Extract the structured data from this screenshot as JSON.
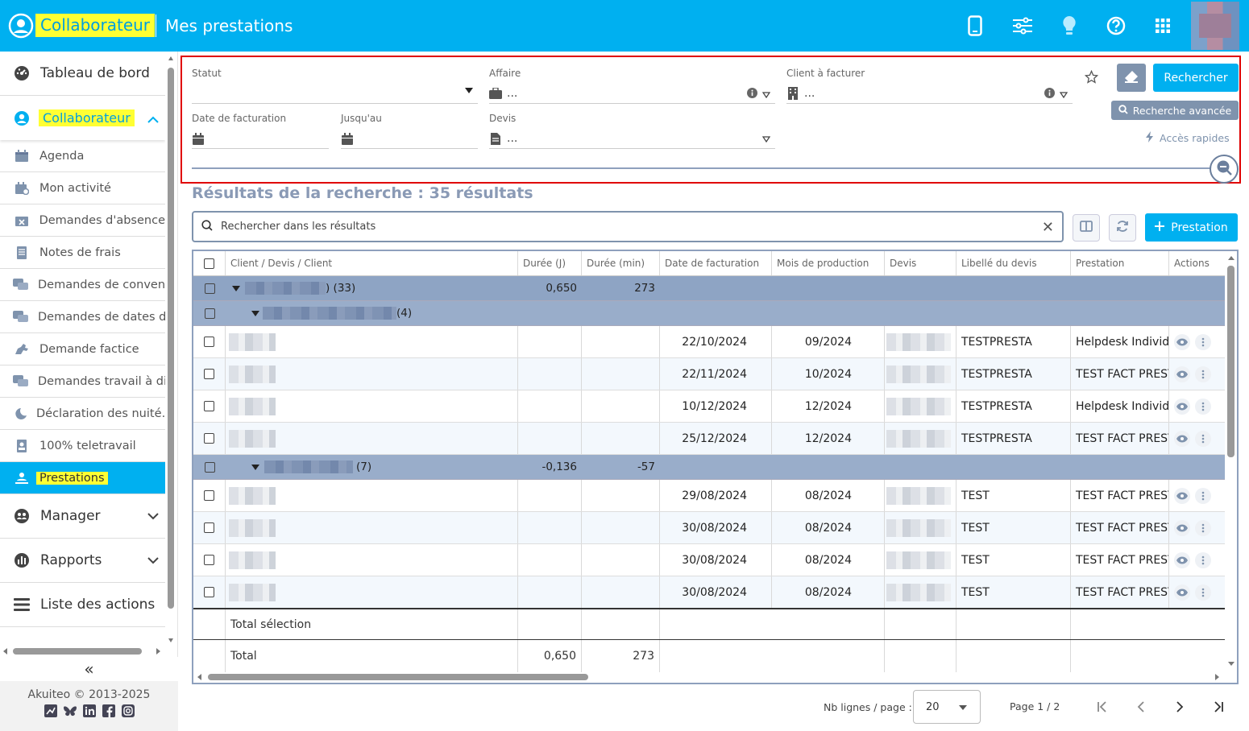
{
  "header": {
    "brand": "Collaborateur",
    "title": "Mes prestations",
    "icons": [
      "mobile-icon",
      "sliders-icon",
      "lightbulb-icon",
      "help-icon",
      "apps-grid-icon"
    ]
  },
  "sidebar": {
    "top_items": [
      {
        "label": "Tableau de bord",
        "icon": "dashboard-icon"
      }
    ],
    "section": {
      "label": "Collaborateur",
      "icon": "user-circle-icon"
    },
    "sub_items": [
      {
        "label": "Agenda",
        "icon": "calendar-icon"
      },
      {
        "label": "Mon activité",
        "icon": "calendar-user-icon"
      },
      {
        "label": "Demandes d'absence",
        "icon": "calendar-x-icon"
      },
      {
        "label": "Notes de frais",
        "icon": "receipt-icon"
      },
      {
        "label": "Demandes de conven…",
        "icon": "chat-icon"
      },
      {
        "label": "Demandes de dates d…",
        "icon": "chat-icon"
      },
      {
        "label": "Demande factice",
        "icon": "horse-icon"
      },
      {
        "label": "Demandes travail à di…",
        "icon": "chat-icon"
      },
      {
        "label": "Déclaration des nuité…",
        "icon": "moon-icon"
      },
      {
        "label": "100% teletravail",
        "icon": "badge-icon"
      },
      {
        "label": "Prestations",
        "icon": "user-upload-icon",
        "active": true
      }
    ],
    "bottom_items": [
      {
        "label": "Manager",
        "icon": "users-icon"
      },
      {
        "label": "Rapports",
        "icon": "report-icon"
      },
      {
        "label": "Liste des actions",
        "icon": "list-icon"
      }
    ],
    "collapse_label": "«",
    "copyright": "Akuiteo © 2013-2025"
  },
  "search_panel": {
    "statut_label": "Statut",
    "affaire_label": "Affaire",
    "affaire_value": "...",
    "client_label": "Client à facturer",
    "client_value": "...",
    "date_label": "Date de facturation",
    "jusqu_label": "Jusqu'au",
    "devis_label": "Devis",
    "devis_value": "...",
    "search_button": "Rechercher",
    "advanced_button": "Recherche avancée",
    "quick_access": "Accès rapides"
  },
  "results": {
    "title": "Résultats de la recherche : 35 résultats",
    "search_placeholder": "Rechercher dans les résultats",
    "add_button": "Prestation"
  },
  "grid": {
    "columns": [
      "Client / Devis / Client",
      "Durée (J)",
      "Durée (min)",
      "Date de facturation",
      "Mois de production",
      "Devis",
      "Libellé du devis",
      "Prestation",
      "Actions"
    ],
    "group1": {
      "count": ") (33)",
      "duree_j": "0,650",
      "duree_min": "273"
    },
    "group1a": {
      "count": "(4)"
    },
    "rows_a": [
      {
        "date": "22/10/2024",
        "mois": "09/2024",
        "libelle": "TESTPRESTA",
        "prestation": "Helpdesk Individuel"
      },
      {
        "date": "22/11/2024",
        "mois": "10/2024",
        "libelle": "TESTPRESTA",
        "prestation": "TEST FACT PRESTA"
      },
      {
        "date": "10/12/2024",
        "mois": "12/2024",
        "libelle": "TESTPRESTA",
        "prestation": "Helpdesk Individuel"
      },
      {
        "date": "25/12/2024",
        "mois": "12/2024",
        "libelle": "TESTPRESTA",
        "prestation": "TEST FACT PRESTA"
      }
    ],
    "group1b": {
      "count": "(7)",
      "duree_j": "-0,136",
      "duree_min": "-57"
    },
    "rows_b": [
      {
        "date": "29/08/2024",
        "mois": "08/2024",
        "libelle": "TEST",
        "prestation": "TEST FACT PRESTA"
      },
      {
        "date": "30/08/2024",
        "mois": "08/2024",
        "libelle": "TEST",
        "prestation": "TEST FACT PRESTA"
      },
      {
        "date": "30/08/2024",
        "mois": "08/2024",
        "libelle": "TEST",
        "prestation": "TEST FACT PRESTA"
      },
      {
        "date": "30/08/2024",
        "mois": "08/2024",
        "libelle": "TEST",
        "prestation": "TEST FACT PRESTA"
      }
    ],
    "total_selection_label": "Total sélection",
    "total_label": "Total",
    "total_duree_j": "0,650",
    "total_duree_min": "273"
  },
  "pager": {
    "rows_label": "Nb lignes / page :",
    "rows_value": "20",
    "page_info": "Page 1 / 2"
  },
  "colors": {
    "primary": "#00b0f0",
    "highlight": "#ffff33",
    "group_row": "#8ea4c4",
    "secondary_button": "#7f93ad",
    "frame": "#e00000"
  }
}
